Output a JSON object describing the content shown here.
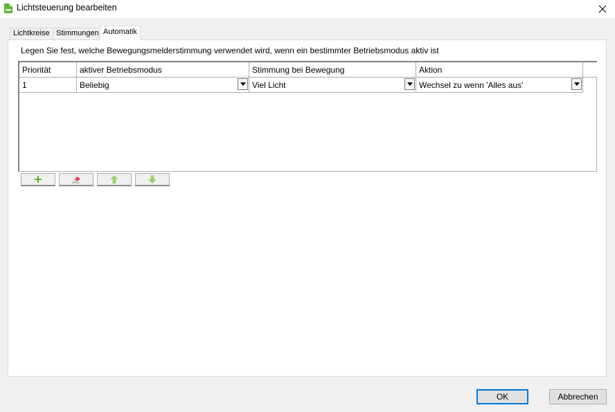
{
  "window": {
    "title": "Lichtsteuerung bearbeiten",
    "app_icon": "app-logo-icon",
    "close_icon": "close-icon"
  },
  "tabs": [
    {
      "label": "Lichtkreise",
      "active": false
    },
    {
      "label": "Stimmungen",
      "active": false
    },
    {
      "label": "Automatik",
      "active": true
    }
  ],
  "description": "Legen Sie fest, welche Bewegungsmelderstimmung verwendet wird, wenn ein bestimmter Betriebsmodus aktiv ist",
  "table": {
    "columns": [
      "Priorität",
      "aktiver Betriebsmodus",
      "Stimmung bei Bewegung",
      "Aktion"
    ],
    "rows": [
      {
        "priority": "1",
        "mode": "Beliebig",
        "mood": "Viel Licht",
        "action": "Wechsel zu wenn 'Alles aus'"
      }
    ]
  },
  "toolbar": {
    "add_icon": "plus-icon",
    "delete_icon": "eraser-icon",
    "up_icon": "arrow-up-icon",
    "down_icon": "arrow-down-icon"
  },
  "footer": {
    "ok_label": "OK",
    "cancel_label": "Abbrechen"
  },
  "colors": {
    "accent": "#0078d7",
    "green_icon": "#5cb130",
    "eraser": "#e8445a"
  }
}
